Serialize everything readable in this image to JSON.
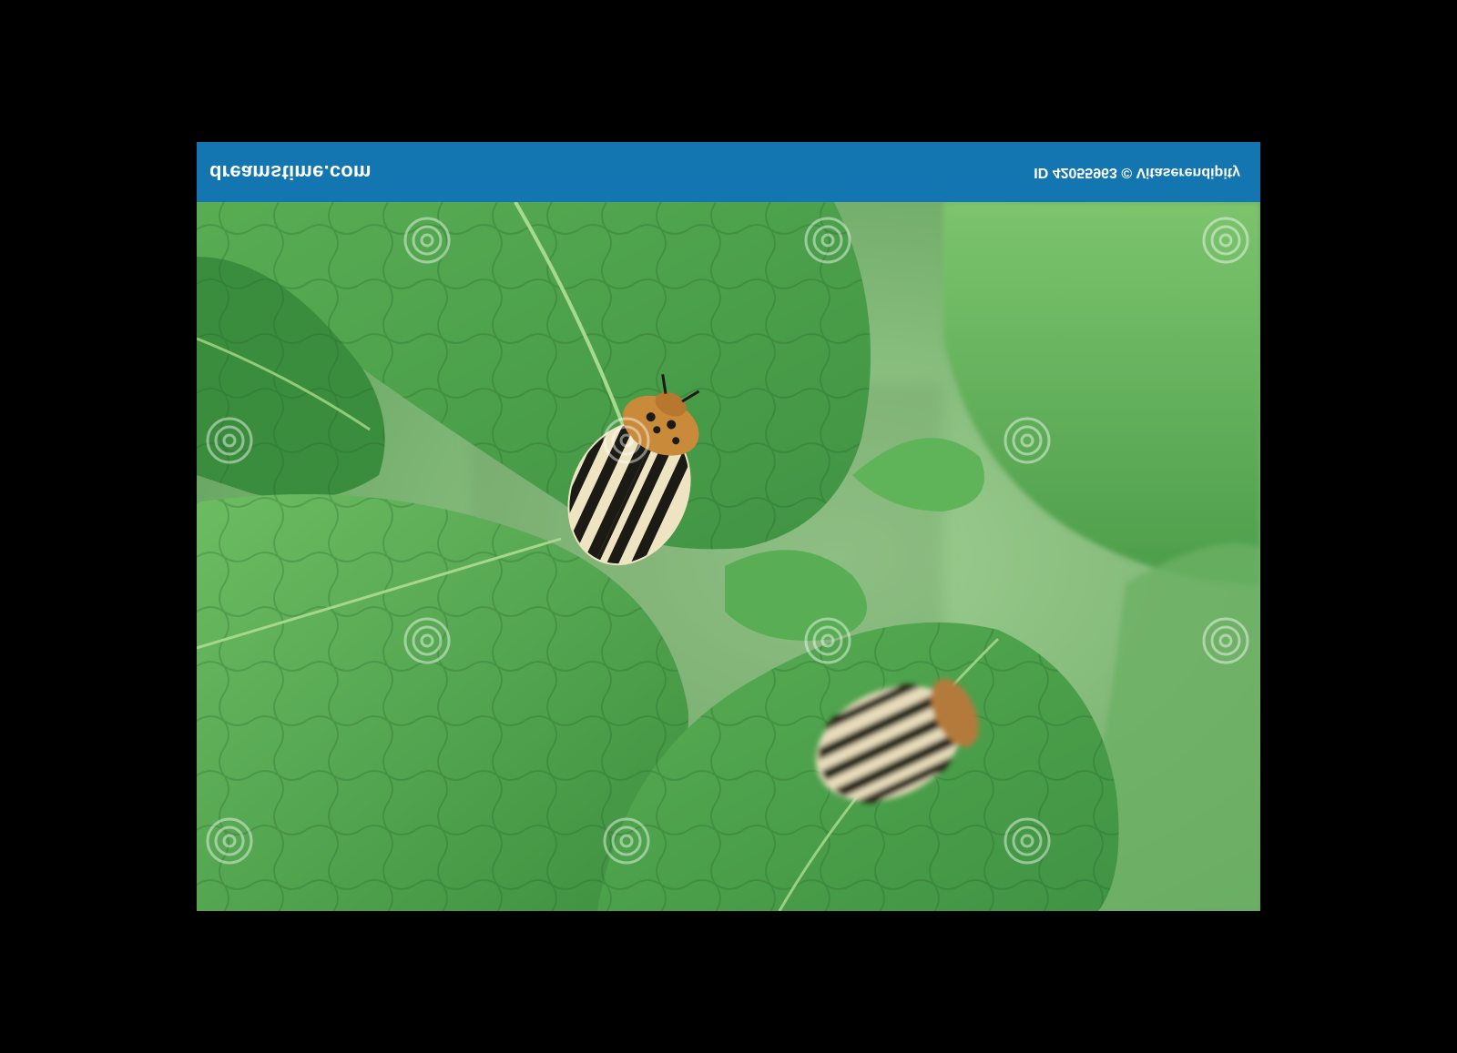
{
  "image": {
    "description_colors": {
      "background": "#000000",
      "banner": "#1476b0",
      "leaf_main": "#4aa24a",
      "leaf_light": "#7fc46f",
      "leaf_dark": "#2f7f35",
      "beetle_stripe_dark": "#1b1a14",
      "beetle_stripe_light": "#efe4c2",
      "beetle_head": "#c98a3a"
    }
  },
  "banner": {
    "brand": "dreamstime.com",
    "credit": "ID 42055963 © Vitaserendipity"
  },
  "watermark": {
    "text": "dreamstime"
  }
}
